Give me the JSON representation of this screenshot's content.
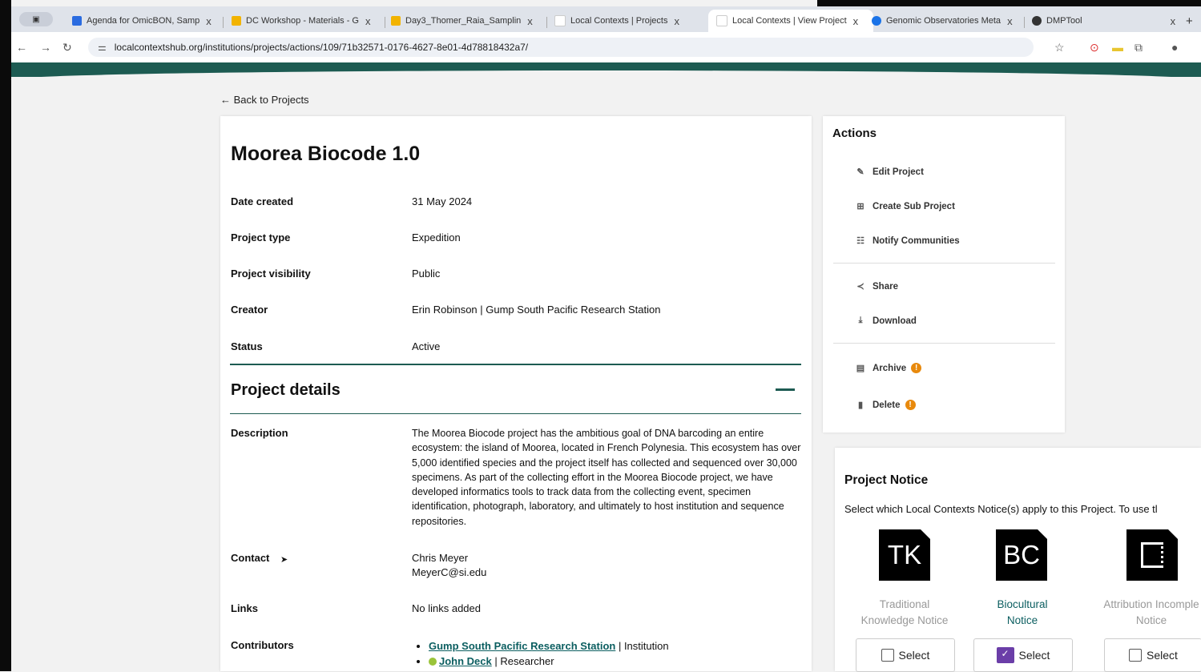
{
  "browser": {
    "tabs": [
      {
        "label": "Agenda for OmicBON, Samp",
        "color": "#2a6be0"
      },
      {
        "label": "DC Workshop - Materials - G",
        "color": "#f2b300"
      },
      {
        "label": "Day3_Thomer_Raia_Samplin",
        "color": "#f2b300"
      },
      {
        "label": "Local Contexts | Projects",
        "color": "#ffffff"
      },
      {
        "label": "Local Contexts | View Project",
        "color": "#ffffff"
      },
      {
        "label": "Genomic Observatories Meta",
        "color": "#1a73e8"
      },
      {
        "label": "DMPTool",
        "color": "#333333"
      }
    ],
    "close_glyph": "x",
    "url": "localcontextshub.org/institutions/projects/actions/109/71b32571-0176-4627-8e01-4d78818432a7/"
  },
  "back_link": "Back to Projects",
  "project": {
    "title": "Moorea Biocode 1.0",
    "fields": [
      {
        "label": "Date created",
        "value": "31 May 2024"
      },
      {
        "label": "Project type",
        "value": "Expedition"
      },
      {
        "label": "Project visibility",
        "value": "Public"
      },
      {
        "label": "Creator",
        "value": "Erin Robinson | Gump South Pacific Research Station"
      },
      {
        "label": "Status",
        "value": "Active"
      }
    ],
    "details_heading": "Project details",
    "description_label": "Description",
    "description": "The Moorea Biocode project has the ambitious goal of DNA barcoding an entire ecosystem: the island of Moorea, located in French Polynesia. This ecosystem has over 5,000 identified species and the project itself has collected and sequenced over 30,000 specimens. As part of the collecting effort in the Moorea Biocode project, we have developed informatics tools to track data from the collecting event, specimen identification, photograph, laboratory, and ultimately to host institution and sequence repositories.",
    "contact_label": "Contact",
    "contact_name": "Chris Meyer",
    "contact_email": "MeyerC@si.edu",
    "links_label": "Links",
    "links_value": "No links added",
    "contributors_label": "Contributors",
    "contributors": [
      {
        "name": "Gump South Pacific Research Station",
        "role": "| Institution"
      },
      {
        "name": "John Deck",
        "role": "| Researcher"
      }
    ]
  },
  "actions": {
    "heading": "Actions",
    "items": [
      {
        "label": "Edit Project",
        "icon": "edit-icon"
      },
      {
        "label": "Create Sub Project",
        "icon": "subproject-icon"
      },
      {
        "label": "Notify Communities",
        "icon": "users-icon"
      },
      {
        "label": "Share",
        "icon": "share-icon"
      },
      {
        "label": "Download",
        "icon": "download-icon"
      },
      {
        "label": "Archive",
        "icon": "archive-icon",
        "warning": "!"
      },
      {
        "label": "Delete",
        "icon": "trash-icon",
        "warning": "!"
      }
    ]
  },
  "notice": {
    "heading": "Project Notice",
    "subtitle": "Select which Local Contexts Notice(s) apply to this Project. To use tl",
    "items": [
      {
        "abbr": "TK",
        "label_line1": "Traditional",
        "label_line2": "Knowledge Notice",
        "selected": false,
        "button": "Select"
      },
      {
        "abbr": "BC",
        "label_line1": "Biocultural",
        "label_line2": "Notice",
        "selected": true,
        "button": "Select"
      },
      {
        "abbr": "",
        "label_line1": "Attribution Incomple",
        "label_line2": "Notice",
        "selected": false,
        "button": "Select"
      }
    ]
  },
  "colors": {
    "accent": "#1d5b52",
    "link": "#0b5e60",
    "warning": "#e8890c",
    "checkbox_on": "#6b3ea8"
  }
}
